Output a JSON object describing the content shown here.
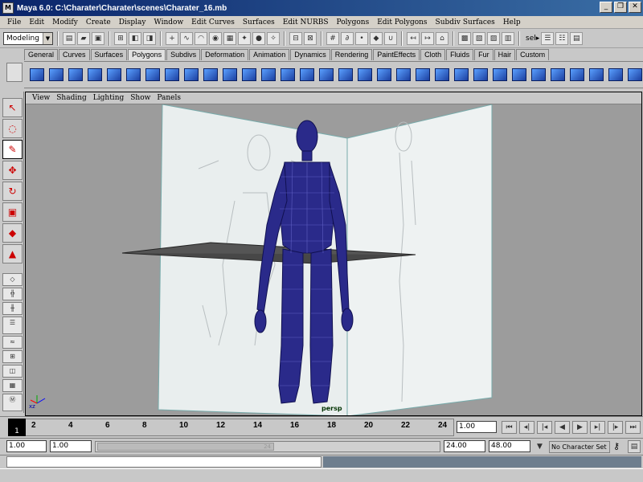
{
  "window": {
    "title": "Maya 6.0: C:\\Charater\\Charater\\scenes\\Charater_16.mb",
    "app_icon": "M"
  },
  "menubar": {
    "items": [
      "File",
      "Edit",
      "Modify",
      "Create",
      "Display",
      "Window",
      "Edit Curves",
      "Surfaces",
      "Edit NURBS",
      "Polygons",
      "Edit Polygons",
      "Subdiv Surfaces",
      "Help"
    ]
  },
  "statusline": {
    "mode": "Modeling",
    "select_label": "sel▸"
  },
  "shelf": {
    "tabs": [
      "General",
      "Curves",
      "Surfaces",
      "Polygons",
      "Subdivs",
      "Deformation",
      "Animation",
      "Dynamics",
      "Rendering",
      "PaintEffects",
      "Cloth",
      "Fluids",
      "Fur",
      "Hair",
      "Custom"
    ],
    "active_tab": "Polygons"
  },
  "panel": {
    "menu": [
      "View",
      "Shading",
      "Lighting",
      "Show",
      "Panels"
    ],
    "camera_label": "persp",
    "axis_label": "xz"
  },
  "timeslider": {
    "ticks": [
      "2",
      "4",
      "6",
      "8",
      "10",
      "12",
      "14",
      "16",
      "18",
      "20",
      "22",
      "24"
    ],
    "current_frame": "1",
    "current_time_field": "1.00"
  },
  "rangeslider": {
    "start_time": "1.00",
    "playback_start": "1.00",
    "thumb_label": "24",
    "playback_end": "24.00",
    "end_time": "48.00",
    "character_set": "No Character Set"
  },
  "colors": {
    "accent_blue": "#1c3fa0",
    "wireframe": "#1a1a7a",
    "viewport_bg": "#9c9c9c"
  }
}
